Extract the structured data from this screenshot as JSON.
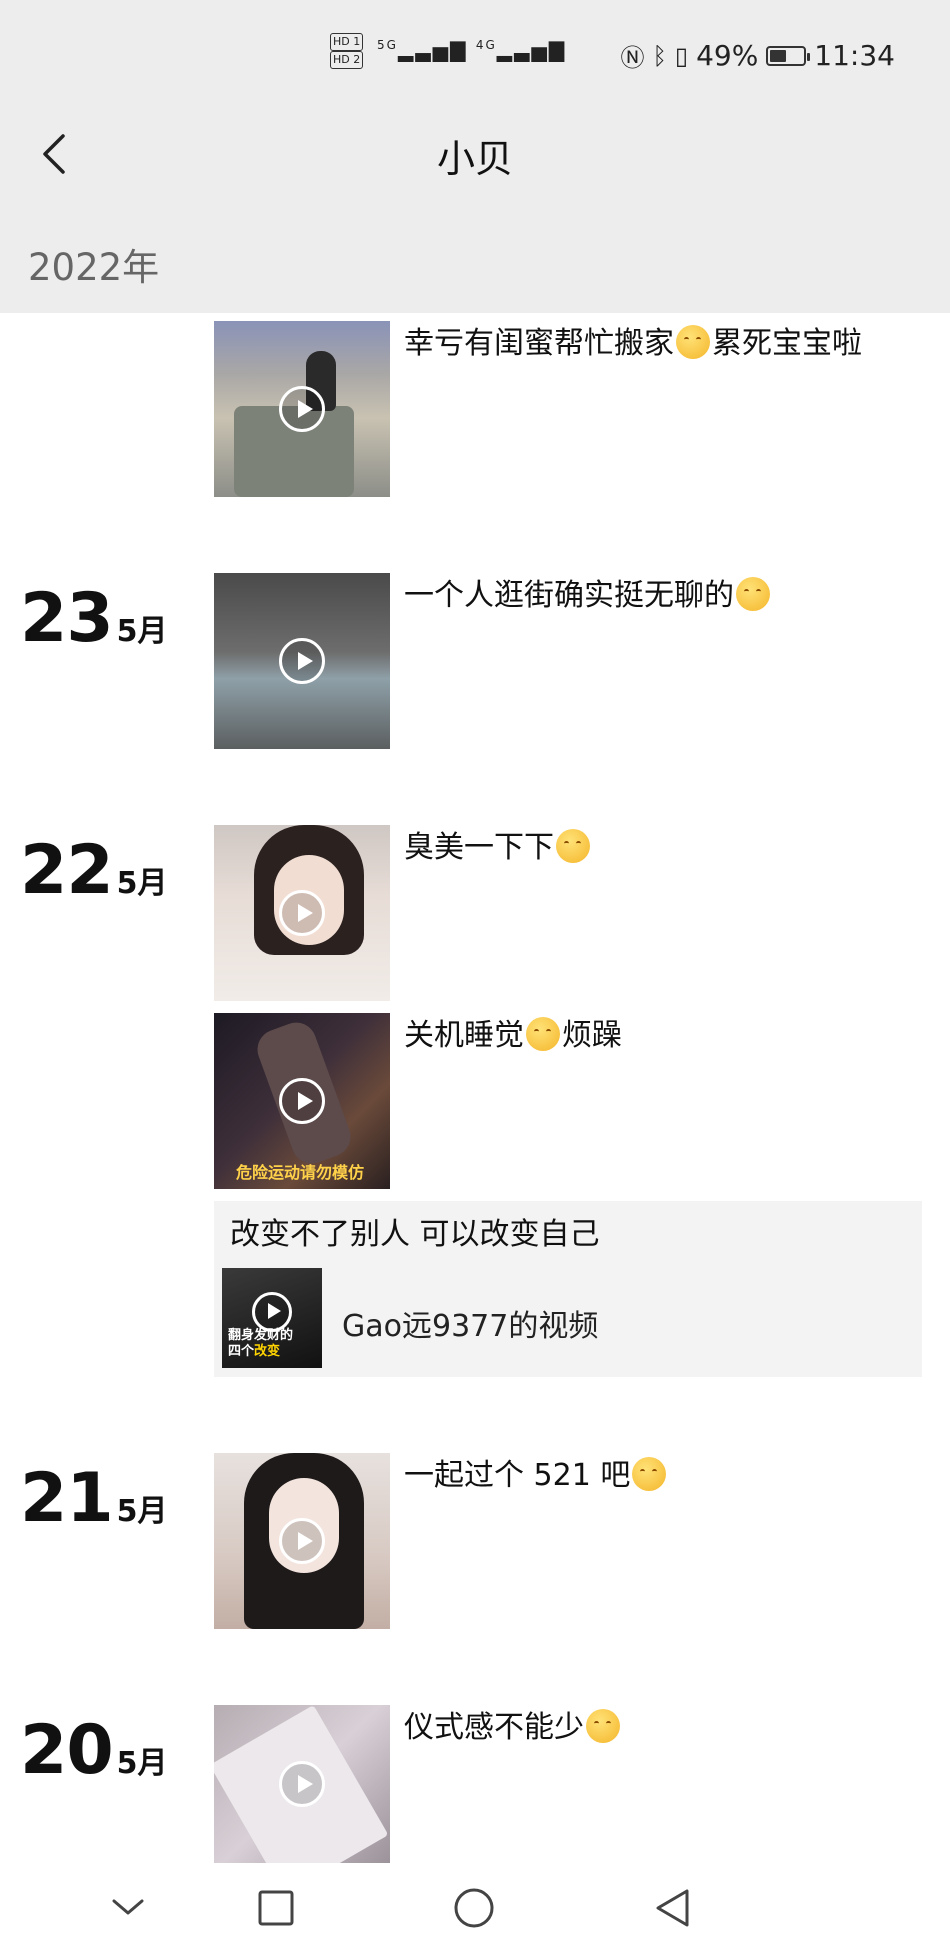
{
  "status_bar": {
    "sim1": "HD 1",
    "sim2": "HD 2",
    "net1": "5G",
    "net2": "4G",
    "battery_percent": "49%",
    "battery_level": 0.49,
    "time": "11:34"
  },
  "nav": {
    "title": "小贝"
  },
  "year": "2022年",
  "posts": [
    {
      "caption_a": "幸亏有闺蜜帮忙搬家",
      "caption_b": "累死宝宝啦"
    },
    {
      "day": "23",
      "month": "5月",
      "caption_a": "一个人逛街确实挺无聊的",
      "caption_b": ""
    },
    {
      "day": "22",
      "month": "5月",
      "caption_a": "臭美一下下",
      "caption_b": ""
    },
    {
      "caption_a": "关机睡觉",
      "caption_b": "烦躁",
      "thumb_text": "危险运动请勿模仿"
    },
    {
      "day": "21",
      "month": "5月",
      "caption_a": "一起过个 521 吧",
      "caption_b": ""
    },
    {
      "day": "20",
      "month": "5月",
      "caption_a": "仪式感不能少",
      "caption_b": ""
    }
  ],
  "share": {
    "text": "改变不了别人 可以改变自己",
    "thumb_line1": "翻身发财的",
    "thumb_line2a": "四个",
    "thumb_line2b": "改变",
    "title": "Gao远9377的视频"
  },
  "icons": {
    "back": "chevron-left-icon",
    "play": "play-icon",
    "emoji": "emoji-icon",
    "nav_back": "triangle-back-icon",
    "nav_home": "circle-home-icon",
    "nav_recent": "square-recent-icon",
    "nav_down": "chevron-down-icon"
  },
  "colors": {
    "header_bg": "#ededed",
    "share_bg": "#f3f3f3"
  }
}
